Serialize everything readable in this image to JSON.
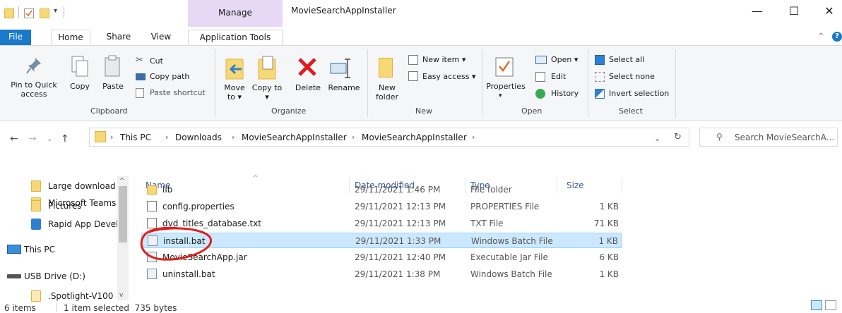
{
  "window": {
    "title": "MovieSearchAppInstaller",
    "context_tab_header": "Manage",
    "minimize": "—",
    "maximize": "☐",
    "close": "✕"
  },
  "ribbon_tabs": [
    "File",
    "Home",
    "Share",
    "View",
    "Application Tools"
  ],
  "ribbon": {
    "clipboard": {
      "pin": "Pin to Quick access",
      "copy": "Copy",
      "paste": "Paste",
      "cut": "Cut",
      "copy_path": "Copy path",
      "paste_shortcut": "Paste shortcut",
      "group": "Clipboard"
    },
    "organize": {
      "move_to": "Move to ▾",
      "copy_to": "Copy to ▾",
      "delete": "Delete",
      "rename": "Rename",
      "group": "Organize"
    },
    "new": {
      "new_item": "New item ▾",
      "easy_access": "Easy access ▾",
      "new_folder": "New folder",
      "group": "New"
    },
    "open": {
      "properties": "Properties",
      "open": "Open ▾",
      "edit": "Edit",
      "history": "History",
      "group": "Open"
    },
    "select": {
      "select_all": "Select all",
      "select_none": "Select none",
      "invert": "Invert selection",
      "group": "Select"
    }
  },
  "address": {
    "crumbs": [
      "This PC",
      "Downloads",
      "MovieSearchAppInstaller",
      "MovieSearchAppInstaller"
    ],
    "search_placeholder": "Search MovieSearchA..."
  },
  "nav_pane": [
    {
      "label": "Large download",
      "icon": "folder"
    },
    {
      "label": "Microsoft Teams",
      "icon": "folder"
    },
    {
      "label": "Pictures",
      "icon": "folder"
    },
    {
      "label": "Rapid App Devel",
      "icon": "app"
    },
    {
      "label": "This PC",
      "icon": "pc"
    },
    {
      "label": "USB Drive (D:)",
      "icon": "drive"
    },
    {
      "label": ".Spotlight-V100",
      "icon": "folder"
    }
  ],
  "columns": {
    "name": "Name",
    "date": "Date modified",
    "type": "Type",
    "size": "Size"
  },
  "files": [
    {
      "name": "lib",
      "date": "29/11/2021 1:46 PM",
      "type": "File folder",
      "size": "",
      "icon": "folder"
    },
    {
      "name": "config.properties",
      "date": "29/11/2021 12:13 PM",
      "type": "PROPERTIES File",
      "size": "1 KB",
      "icon": "text"
    },
    {
      "name": "dvd_titles_database.txt",
      "date": "29/11/2021 12:13 PM",
      "type": "TXT File",
      "size": "71 KB",
      "icon": "text"
    },
    {
      "name": "install.bat",
      "date": "29/11/2021 1:33 PM",
      "type": "Windows Batch File",
      "size": "1 KB",
      "icon": "bat"
    },
    {
      "name": "MovieSearchApp.jar",
      "date": "29/11/2021 12:40 PM",
      "type": "Executable Jar File",
      "size": "6 KB",
      "icon": "jar"
    },
    {
      "name": "uninstall.bat",
      "date": "29/11/2021 1:38 PM",
      "type": "Windows Batch File",
      "size": "1 KB",
      "icon": "bat"
    }
  ],
  "status": {
    "items": "6 items",
    "selected": "1 item selected  735 bytes"
  },
  "colors": {
    "accent": "#1979ca",
    "selection": "#cce8ff",
    "annotation": "#e0201b"
  }
}
